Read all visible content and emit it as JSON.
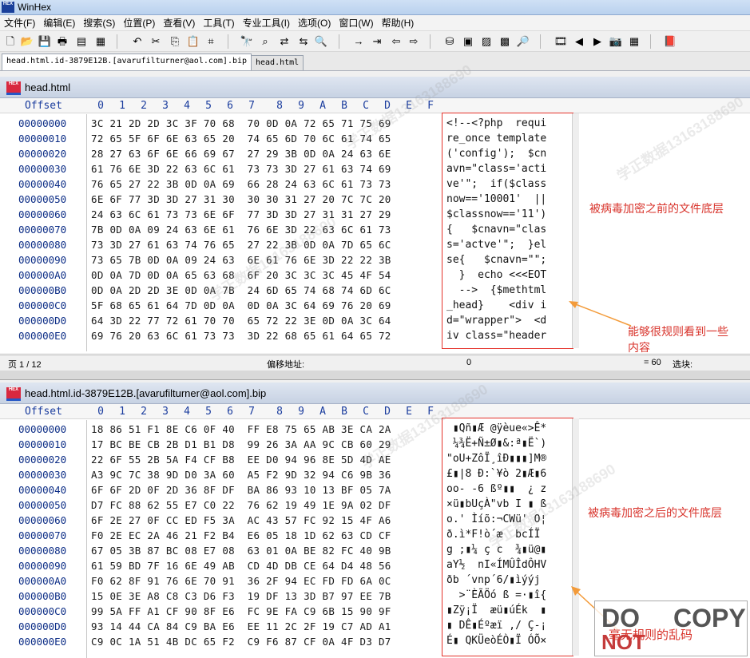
{
  "window": {
    "title": "WinHex"
  },
  "menu": [
    "文件(F)",
    "编辑(E)",
    "搜索(S)",
    "位置(P)",
    "查看(V)",
    "工具(T)",
    "专业工具(I)",
    "选项(O)",
    "窗口(W)",
    "帮助(H)"
  ],
  "tabs": [
    "head.html.id-3879E12B.[avarufilturner@aol.com].bip",
    "head.html"
  ],
  "hex_columns": [
    "0",
    "1",
    "2",
    "3",
    "4",
    "5",
    "6",
    "7",
    "8",
    "9",
    "A",
    "B",
    "C",
    "D",
    "E",
    "F"
  ],
  "offset_label": "Offset",
  "top_panel": {
    "title": "head.html",
    "offsets": [
      "00000000",
      "00000010",
      "00000020",
      "00000030",
      "00000040",
      "00000050",
      "00000060",
      "00000070",
      "00000080",
      "00000090",
      "000000A0",
      "000000B0",
      "000000C0",
      "000000D0",
      "000000E0"
    ],
    "hex": [
      "3C 21 2D 2D 3C 3F 70 68  70 0D 0A 72 65 71 75 69",
      "72 65 5F 6F 6E 63 65 20  74 65 6D 70 6C 61 74 65",
      "28 27 63 6F 6E 66 69 67  27 29 3B 0D 0A 24 63 6E",
      "61 76 6E 3D 22 63 6C 61  73 73 3D 27 61 63 74 69",
      "76 65 27 22 3B 0D 0A 69  66 28 24 63 6C 61 73 73",
      "6E 6F 77 3D 3D 27 31 30  30 30 31 27 20 7C 7C 20",
      "24 63 6C 61 73 73 6E 6F  77 3D 3D 27 31 31 27 29",
      "7B 0D 0A 09 24 63 6E 61  76 6E 3D 22 63 6C 61 73",
      "73 3D 27 61 63 74 76 65  27 22 3B 0D 0A 7D 65 6C",
      "73 65 7B 0D 0A 09 24 63  6E 61 76 6E 3D 22 22 3B",
      "0D 0A 7D 0D 0A 65 63 68  6F 20 3C 3C 3C 45 4F 54",
      "0D 0A 2D 2D 3E 0D 0A 7B  24 6D 65 74 68 74 6D 6C",
      "5F 68 65 61 64 7D 0D 0A  0D 0A 3C 64 69 76 20 69",
      "64 3D 22 77 72 61 70 70  65 72 22 3E 0D 0A 3C 64",
      "69 76 20 63 6C 61 73 73  3D 22 68 65 61 64 65 72"
    ],
    "text": [
      "<!--<?php  requi",
      "re_once template",
      "('config');  $cn",
      "avn=\"class='acti",
      "ve'\";  if($class",
      "now=='10001'  ||",
      "$classnow=='11')",
      "{   $cnavn=\"clas",
      "s='actve'\";  }el",
      "se{   $cnavn=\"\";",
      "  }  echo <<<EOT",
      "  -->  {$methtml",
      "_head}    <div i",
      "d=\"wrapper\">  <d",
      "iv class=\"header"
    ],
    "status": {
      "page": "页 1 / 12",
      "offset_label": "偏移地址:",
      "offset_value": "0",
      "equals": "= 60",
      "selection": "选块:"
    }
  },
  "bottom_panel": {
    "title": "head.html.id-3879E12B.[avarufilturner@aol.com].bip",
    "offsets": [
      "00000000",
      "00000010",
      "00000020",
      "00000030",
      "00000040",
      "00000050",
      "00000060",
      "00000070",
      "00000080",
      "00000090",
      "000000A0",
      "000000B0",
      "000000C0",
      "000000D0",
      "000000E0"
    ],
    "hex": [
      "18 86 51 F1 8E C6 0F 40  FF E8 75 65 AB 3E CA 2A",
      "17 BC BE CB 2B D1 B1 D8  99 26 3A AA 9C CB 60 29",
      "22 6F 55 2B 5A F4 CF B8  EE D0 94 96 8E 5D 4D AE",
      "A3 9C 7C 38 9D D0 3A 60  A5 F2 9D 32 94 C6 9B 36",
      "6F 6F 2D 0F 2D 36 8F DF  BA 86 93 10 13 BF 05 7A",
      "D7 FC 88 62 55 E7 C0 22  76 62 19 49 1E 9A 02 DF",
      "6F 2E 27 0F CC ED F5 3A  AC 43 57 FC 92 15 4F A6",
      "F0 2E EC 2A 46 21 F2 B4  E6 05 18 1D 62 63 CD CF",
      "67 05 3B 87 BC 08 E7 08  63 01 0A BE 82 FC 40 9B",
      "61 59 BD 7F 16 6E 49 AB  CD 4D DB CE 64 D4 48 56",
      "F0 62 8F 91 76 6E 70 91  36 2F 94 EC FD FD 6A 0C",
      "15 0E 3E A8 C8 C3 D6 F3  19 DF 13 3D B7 97 EE 7B",
      "99 5A FF A1 CF 90 8F E6  FC 9E FA C9 6B 15 90 9F",
      "93 14 44 CA 84 C9 BA E6  EE 11 2C 2F 19 C7 AD A1",
      "C9 0C 1A 51 4B DC 65 F2  C9 F6 87 CF 0A 4F D3 D7"
    ],
    "text": [
      " ▮Qñ▮Æ @ÿèue«>Ê*",
      " ¼¾Ë+Ñ±Ø▮&:ª▮Ë`)",
      "\"oU+ZôÏ¸îÐ▮▮▮]M®",
      "£▮|8 Ð:`¥ò 2▮Æ▮6",
      "oo- -6 ßº▮▮  ¿ z",
      "×ü▮bUçÀ\"vb I ▮ ß",
      "o.' Ìíõ:¬CWü' O¦",
      "ð.ì*F!ò´æ  bcÍÏ",
      "g ;▮¼ ç c  ¾▮ü@▮",
      "aY½  nI«ÍMÛÎdÔHV",
      "ðb ´vnp´6/▮ìýýj ",
      "  >¨ÈÃÖó ß =·▮î{",
      "▮Zÿ¡Ï  æü▮úÉk  ▮",
      "▮ DÊ▮Éºæï ,/ Ç-¡",
      "É▮ QKÜeòÉÒ▮Ï ÓÕ×"
    ]
  },
  "annotations": {
    "before": "被病毒加密之前的文件底层",
    "regular": [
      "能够很规则看到一些",
      "内容"
    ],
    "after": "被病毒加密之后的文件底层",
    "garbled": "毫无规则的乱码"
  },
  "watermark": {
    "text": "学正数据13163188690",
    "stamp_do": "DO",
    "stamp_copy": "COPY",
    "stamp_not": "NOT"
  },
  "colors": {
    "accent": "#e5332b",
    "offset_text": "#0c2d86",
    "title_bar": "#cfe0f5"
  }
}
